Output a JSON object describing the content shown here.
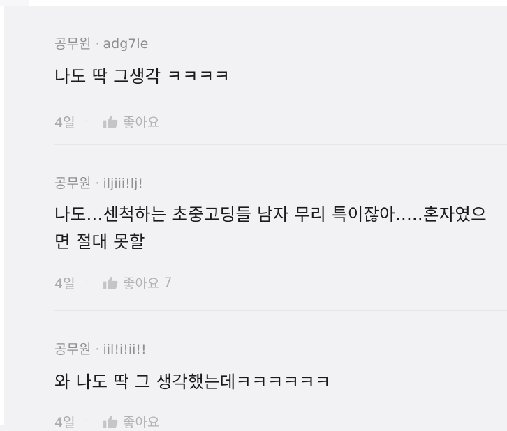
{
  "comments": [
    {
      "author": "공무원",
      "separator": "·",
      "nickname": "adg7le",
      "body": "나도 딱 그생각 ㅋㅋㅋㅋ",
      "date": "4일",
      "dot": "·",
      "like_label": "좋아요",
      "like_count": ""
    },
    {
      "author": "공무원",
      "separator": "·",
      "nickname": "iljiii!lj!",
      "body": "나도...센척하는 초중고딩들 남자 무리 특이잖아.....혼자였으면 절대 못할",
      "date": "4일",
      "dot": "·",
      "like_label": "좋아요",
      "like_count": "7"
    },
    {
      "author": "공무원",
      "separator": "·",
      "nickname": "iil!i!ii!!",
      "body": "와 나도 딱 그 생각했는데ㅋㅋㅋㅋㅋㅋ",
      "date": "4일",
      "dot": "·",
      "like_label": "좋아요",
      "like_count": ""
    }
  ],
  "icons": {
    "like": "thumbs-up-icon"
  },
  "colors": {
    "background": "#f2f2f4",
    "text_primary": "#1b1b1d",
    "text_secondary": "#8e8e93",
    "text_muted": "#b4b4b8"
  }
}
